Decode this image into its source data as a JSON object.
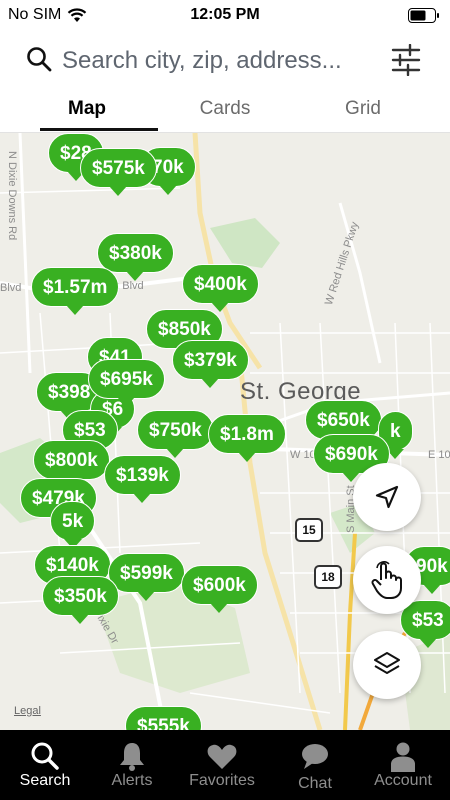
{
  "status_bar": {
    "carrier": "No SIM",
    "time": "12:05 PM"
  },
  "search": {
    "placeholder": "Search city, zip, address..."
  },
  "tabs": [
    {
      "label": "Map",
      "active": true
    },
    {
      "label": "Cards",
      "active": false
    },
    {
      "label": "Grid",
      "active": false
    }
  ],
  "map": {
    "city": "St. George",
    "street_labels": {
      "dixie_downs": "N Dixie Downs Rd",
      "red_hills": "W Red Hills Pkwy",
      "w_100": "W 10",
      "e_100": "E 10",
      "main_st": "S Main St",
      "blvd": "Blvd",
      "sunset": "et Blvd",
      "dixie_dr": "ixie Dr"
    },
    "route_shields": [
      "15",
      "18"
    ],
    "legal": "Legal",
    "pins": [
      "$28",
      "$575k",
      "70k",
      "$380k",
      "$1.57m",
      "$400k",
      "$850k",
      "$41",
      "$379k",
      "$695k",
      "$398",
      "$6",
      "$800k",
      "$750k",
      "$1.8m",
      "$53",
      "$650k",
      "$690k",
      "k",
      "$800k",
      "$139k",
      "$479k",
      "5k",
      "$140k",
      "$599k",
      "$600k",
      "$350k",
      "90k",
      "$53",
      "$555k"
    ]
  },
  "colors": {
    "pin_green": "#39b022",
    "nav_bg": "#000000"
  },
  "fabs": {
    "locate": "navigation-arrow-icon",
    "draw": "hand-pointer-icon",
    "layers": "layers-icon"
  },
  "nav": [
    {
      "label": "Search",
      "icon": "search-icon",
      "active": true
    },
    {
      "label": "Alerts",
      "icon": "bell-icon",
      "active": false
    },
    {
      "label": "Favorites",
      "icon": "heart-icon",
      "active": false
    },
    {
      "label": "Chat",
      "icon": "chat-bubble-icon",
      "active": false
    },
    {
      "label": "Account",
      "icon": "person-icon",
      "active": false
    }
  ]
}
